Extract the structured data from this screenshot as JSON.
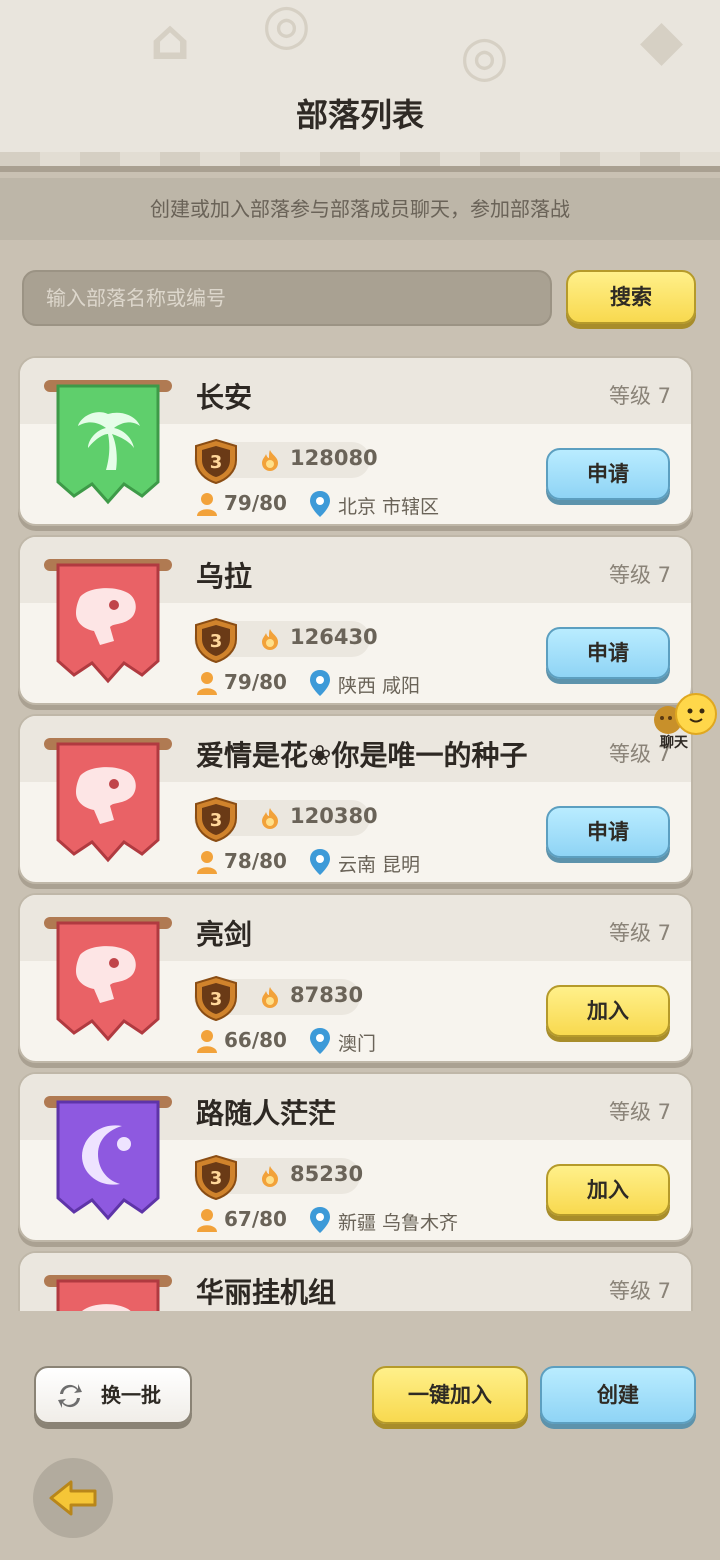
{
  "header": {
    "title": "部落列表",
    "subtitle": "创建或加入部落参与部落成员聊天，参加部落战"
  },
  "search": {
    "placeholder": "输入部落名称或编号",
    "button_label": "搜索"
  },
  "clans": [
    {
      "name": "长安",
      "level": "等级 7",
      "rank": "3",
      "score": "128080",
      "members": "79/80",
      "location": "北京 市辖区",
      "action": "申请",
      "action_style": "blue",
      "banner": "palm"
    },
    {
      "name": "乌拉",
      "level": "等级 7",
      "rank": "3",
      "score": "126430",
      "members": "79/80",
      "location": "陕西 咸阳",
      "action": "申请",
      "action_style": "blue",
      "banner": "dino"
    },
    {
      "name": "爱情是花❀你是唯一的种子",
      "level": "等级 7",
      "rank": "3",
      "score": "120380",
      "members": "78/80",
      "location": "云南 昆明",
      "action": "申请",
      "action_style": "blue",
      "banner": "dino"
    },
    {
      "name": "亮剑",
      "level": "等级 7",
      "rank": "3",
      "score": "87830",
      "members": "66/80",
      "location": "澳门",
      "action": "加入",
      "action_style": "yellow",
      "banner": "dino"
    },
    {
      "name": "路随人茫茫",
      "level": "等级 7",
      "rank": "3",
      "score": "85230",
      "members": "67/80",
      "location": "新疆 乌鲁木齐",
      "action": "加入",
      "action_style": "yellow",
      "banner": "moon"
    },
    {
      "name": "华丽挂机组",
      "level": "等级 7",
      "rank": "",
      "score": "",
      "members": "",
      "location": "",
      "action": "",
      "action_style": "",
      "banner": "dino"
    }
  ],
  "chat": {
    "label": "聊天"
  },
  "footer": {
    "refresh_label": "换一批",
    "onekey_label": "一键加入",
    "create_label": "创建"
  },
  "colors": {
    "green_banner": "#5fcf6c",
    "red_banner": "#e96266",
    "purple_banner": "#8e59e0",
    "button_yellow": "#f8d94f",
    "button_blue": "#8fd4f5"
  }
}
